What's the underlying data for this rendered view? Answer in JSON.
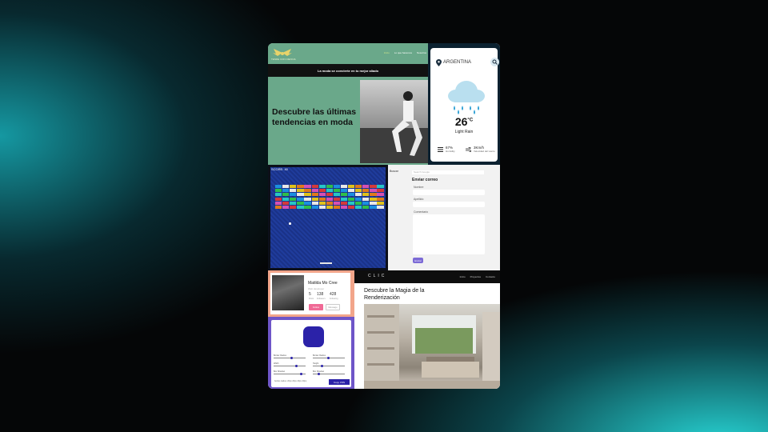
{
  "fashion": {
    "logo_text": "TENDE CON CIENCIA",
    "nav": [
      "Inicio",
      "Lo que hacemos",
      "Nosotros"
    ],
    "banner": "La moda se convierte en tu mejor aliado",
    "headline": "Descubre las últimas tendencias en moda"
  },
  "weather": {
    "location": "ARGENTINA",
    "temperature": "26",
    "unit": "°C",
    "description": "Light Rain",
    "humidity": "67%",
    "humidity_label": "Humidity",
    "wind": "3Km/h",
    "wind_label": "Velocidad del viento",
    "icons": [
      "location-pin",
      "search",
      "rain-cloud",
      "humidity",
      "wind"
    ]
  },
  "breakout": {
    "score": "SCORE: 40",
    "brick_colors": [
      "#1b8fe0",
      "#d43a3a",
      "#e0c21b",
      "#2fbf4a",
      "#d64fb3",
      "#e8e8e8",
      "#27c6c6",
      "#e07a1b"
    ]
  },
  "contact_form": {
    "search_label": "Buscar",
    "search_placeholder": "Search Google",
    "title": "Enviar correo",
    "fields": [
      "Nombre",
      "Apellido",
      "Comentario"
    ],
    "submit": "Enviar"
  },
  "profile": {
    "name": "Matilda Mo Cree",
    "role": "Web developer",
    "stats": [
      {
        "value": "5",
        "label": "Posts"
      },
      {
        "value": "138",
        "label": "Followers"
      },
      {
        "value": "428",
        "label": "Following"
      }
    ],
    "primary_button": "Follow",
    "secondary_button": "Message"
  },
  "shape_generator": {
    "controls": [
      "Border Radius",
      "Border Radius",
      "Width",
      "Height",
      "Box Shadow",
      "Box Shadow"
    ],
    "code": "border-radius: 20px 20px 20px 20px;",
    "copy_button": "Copy CSS",
    "shape_color": "#2b22a8"
  },
  "render": {
    "logo": "CLIC",
    "nav": [
      "Inicio",
      "Proyectos",
      "Contacto"
    ],
    "title": "Descubre la Magia de la Renderización"
  }
}
